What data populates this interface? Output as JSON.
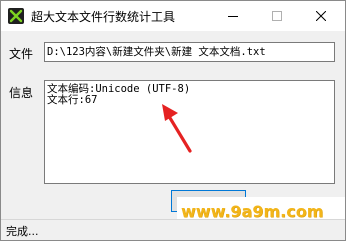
{
  "window": {
    "title": "超大文本文件行数统计工具",
    "controls": {
      "minimize_icon": "minimize-icon",
      "maximize_icon": "maximize-icon",
      "close_icon": "close-icon"
    }
  },
  "file": {
    "label": "文件",
    "value": "D:\\123内容\\新建文件夹\\新建 文本文档.txt"
  },
  "info": {
    "label": "信息",
    "lines": [
      "文本编码:Unicode (UTF-8)",
      "文本行:67"
    ]
  },
  "watermark": {
    "text": "www.9a9m.com",
    "color": "#f2b51a"
  },
  "status": {
    "text": "完成..."
  },
  "colors": {
    "annotation_arrow": "#e52222",
    "accent": "#0078d7"
  }
}
